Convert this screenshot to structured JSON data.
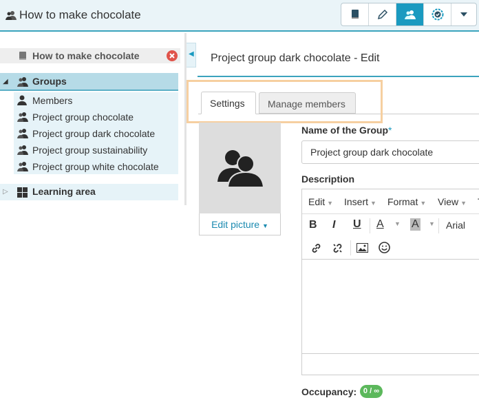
{
  "header": {
    "title": "How to make chocolate",
    "icons": [
      "course-book-icon",
      "pencil-icon",
      "group-icon",
      "settings-badge-icon",
      "caret-down-icon"
    ],
    "accent_color": "#1a9ac0"
  },
  "sidebar": {
    "root_label": "How to make chocolate",
    "groups_label": "Groups",
    "items": [
      {
        "label": "Members",
        "icon": "user-icon"
      },
      {
        "label": "Project group chocolate",
        "icon": "group-icon"
      },
      {
        "label": "Project group dark chocolate",
        "icon": "group-icon"
      },
      {
        "label": "Project group sustainability",
        "icon": "group-icon"
      },
      {
        "label": "Project group white chocolate",
        "icon": "group-icon"
      }
    ],
    "learning_area_label": "Learning area"
  },
  "main": {
    "title": "Project group dark chocolate - Edit",
    "tabs": [
      {
        "label": "Settings",
        "active": true
      },
      {
        "label": "Manage members",
        "active": false
      }
    ],
    "edit_picture_label": "Edit picture",
    "name_label": "Name of the Group",
    "name_required_mark": "*",
    "name_value": "Project group dark chocolate",
    "description_label": "Description",
    "editor": {
      "menus": [
        "Edit",
        "Insert",
        "Format",
        "View"
      ],
      "menu_cut_letter": "T",
      "font_name": "Arial"
    },
    "occupancy_label": "Occupancy:",
    "occupancy_value": "0 / ∞"
  }
}
